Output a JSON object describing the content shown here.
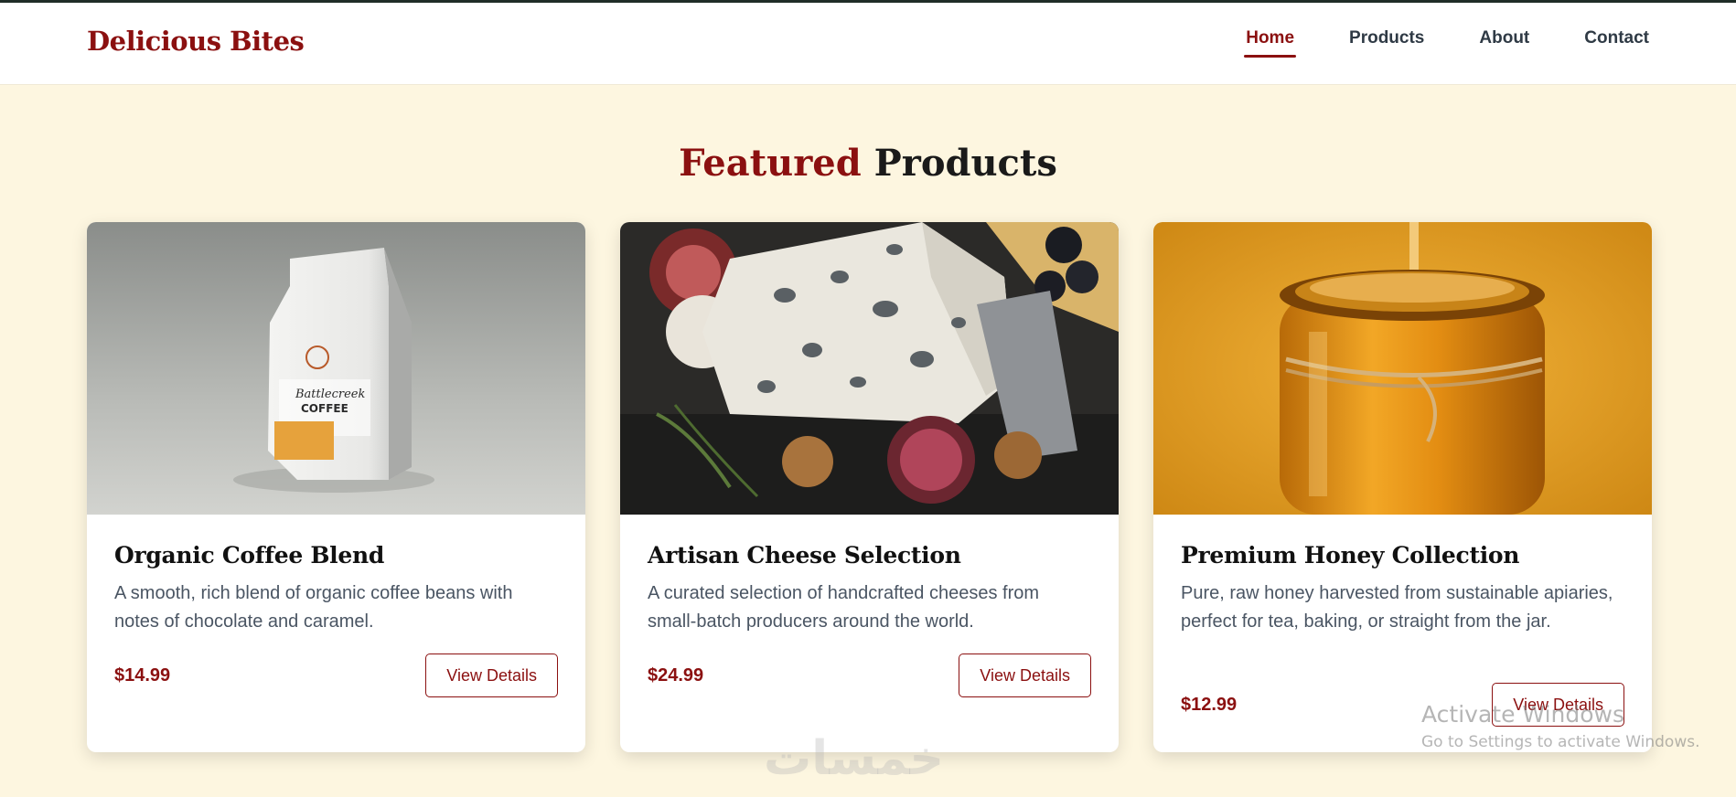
{
  "brand": "Delicious Bites",
  "nav": [
    {
      "label": "Home",
      "active": true
    },
    {
      "label": "Products",
      "active": false
    },
    {
      "label": "About",
      "active": false
    },
    {
      "label": "Contact",
      "active": false
    }
  ],
  "section": {
    "title_accent": "Featured",
    "title_rest": "Products"
  },
  "products": [
    {
      "name": "Organic Coffee Blend",
      "description": "A smooth, rich blend of organic coffee beans with notes of chocolate and caramel.",
      "price": "$14.99",
      "button": "View Details",
      "image_icon": "coffee-bag-image"
    },
    {
      "name": "Artisan Cheese Selection",
      "description": "A curated selection of handcrafted cheeses from small-batch producers around the world.",
      "price": "$24.99",
      "button": "View Details",
      "image_icon": "blue-cheese-image"
    },
    {
      "name": "Premium Honey Collection",
      "description": "Pure, raw honey harvested from sustainable apiaries, perfect for tea, baking, or straight from the jar.",
      "price": "$12.99",
      "button": "View Details",
      "image_icon": "honey-jar-image"
    }
  ],
  "os_watermark": {
    "title": "Activate Windows",
    "subtitle": "Go to Settings to activate Windows."
  },
  "logo_watermark": "خمسات",
  "colors": {
    "accent": "#8b1010",
    "background": "#fdf6e0",
    "text": "#2f3a45"
  }
}
